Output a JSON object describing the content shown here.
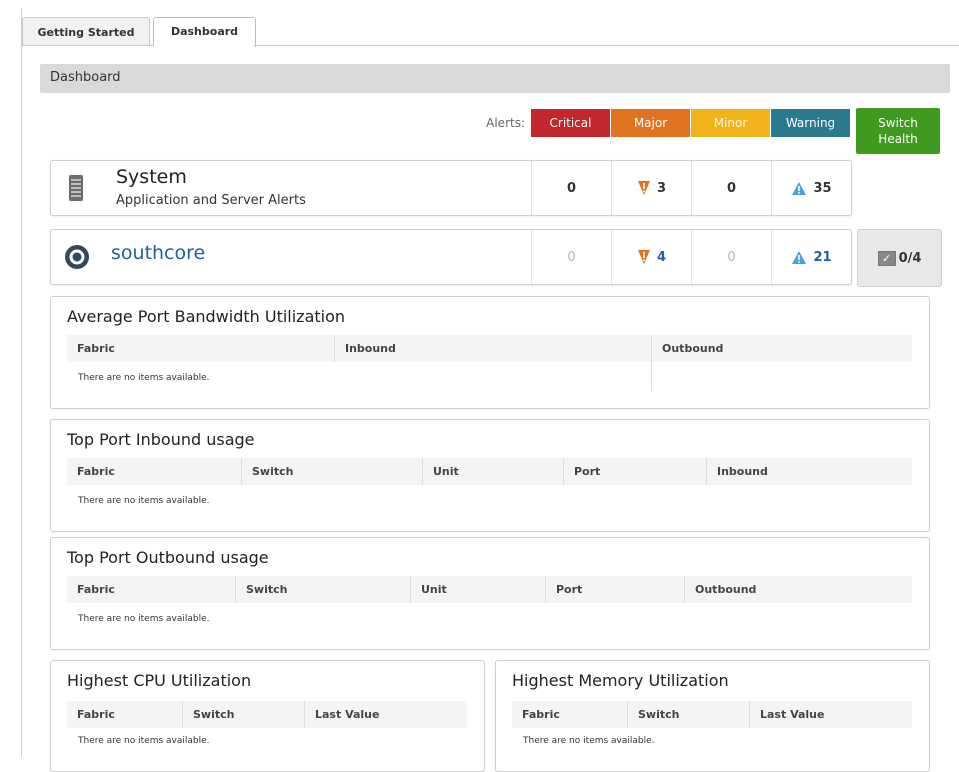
{
  "tabs": [
    {
      "label": "Getting Started"
    },
    {
      "label": "Dashboard"
    }
  ],
  "section": {
    "title": "Dashboard"
  },
  "alerts": {
    "label": "Alerts:",
    "headers": [
      "Critical",
      "Major",
      "Minor",
      "Warning"
    ],
    "switch_health": {
      "line1": "Switch",
      "line2": "Health"
    },
    "colors": {
      "critical": "#c1272d",
      "major": "#e0731f",
      "minor": "#f3b21c",
      "warning": "#2a7a8f",
      "health": "#3f9a1f"
    }
  },
  "rows": [
    {
      "title": "System",
      "subtitle": "Application and Server Alerts",
      "icon": "server-icon",
      "critical": "0",
      "major": "3",
      "minor": "0",
      "warning": "35"
    },
    {
      "title": "southcore",
      "icon": "southcore-icon",
      "critical": "0",
      "major": "4",
      "minor": "0",
      "warning": "21",
      "health": "0/4"
    }
  ],
  "panels": {
    "bandwidth": {
      "title": "Average Port Bandwidth Utilization",
      "columns": [
        "Fabric",
        "Inbound",
        "Outbound"
      ],
      "empty": "There are no items available."
    },
    "inbound": {
      "title": "Top Port Inbound usage",
      "columns": [
        "Fabric",
        "Switch",
        "Unit",
        "Port",
        "Inbound"
      ],
      "empty": "There are no items available."
    },
    "outbound": {
      "title": "Top Port Outbound usage",
      "columns": [
        "Fabric",
        "Switch",
        "Unit",
        "Port",
        "Outbound"
      ],
      "empty": "There are no items available."
    },
    "cpu": {
      "title": "Highest CPU Utilization",
      "columns": [
        "Fabric",
        "Switch",
        "Last Value"
      ],
      "empty": "There are no items available."
    },
    "memory": {
      "title": "Highest Memory Utilization",
      "columns": [
        "Fabric",
        "Switch",
        "Last Value"
      ],
      "empty": "There are no items available."
    }
  }
}
